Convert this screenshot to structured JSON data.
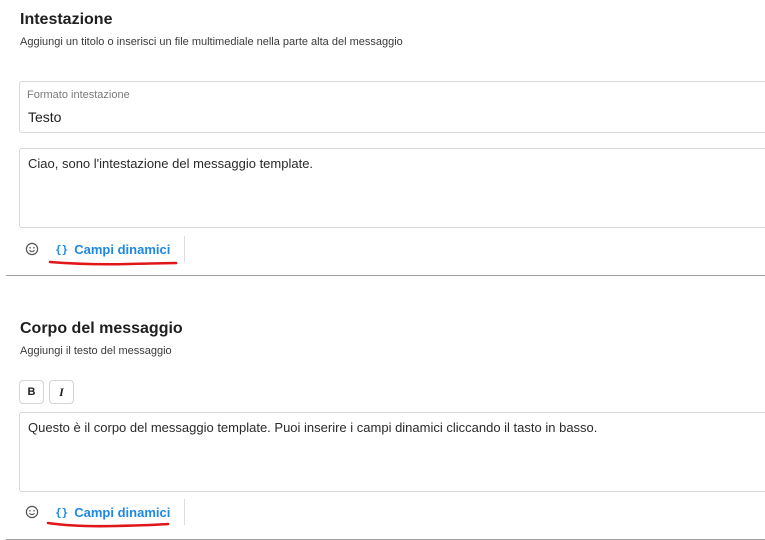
{
  "header_section": {
    "title": "Intestazione",
    "subtitle": "Aggiungi un titolo o inserisci un file multimediale nella parte alta del messaggio",
    "format_field": {
      "label": "Formato intestazione",
      "value": "Testo"
    },
    "text_value": "Ciao, sono l'intestazione del messaggio template.",
    "toolbar": {
      "emoji_icon": "smiley-icon",
      "dynamic_icon": "{}",
      "dynamic_label": "Campi dinamici"
    }
  },
  "body_section": {
    "title": "Corpo del messaggio",
    "subtitle": "Aggiungi il testo del messaggio",
    "format_buttons": {
      "bold": "B",
      "italic": "I"
    },
    "text_value": "Questo è il corpo del messaggio template. Puoi inserire i campi dinamici cliccando il tasto in basso.",
    "toolbar": {
      "emoji_icon": "smiley-icon",
      "dynamic_icon": "{}",
      "dynamic_label": "Campi dinamici"
    }
  },
  "colors": {
    "accent": "#1e88e5",
    "annotation": "#e0161b"
  }
}
